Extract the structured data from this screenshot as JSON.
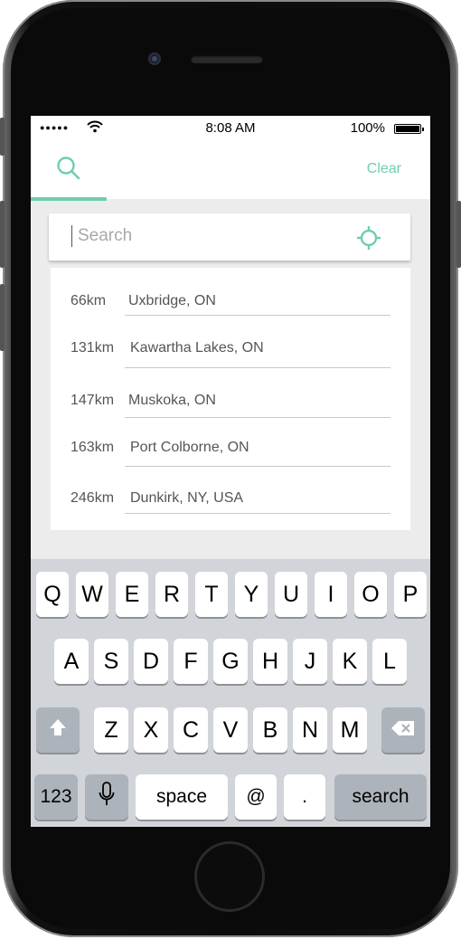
{
  "status_bar": {
    "signal": "●●●●●",
    "time": "8:08 AM",
    "battery_percent": "100%"
  },
  "header": {
    "search_tab_icon": "search-icon",
    "clear_label": "Clear"
  },
  "search": {
    "placeholder": "Search",
    "value": "",
    "locate_icon": "crosshair-icon"
  },
  "results": [
    {
      "distance": "66km",
      "place": "Uxbridge, ON"
    },
    {
      "distance": "131km",
      "place": "Kawartha Lakes, ON"
    },
    {
      "distance": "147km",
      "place": "Muskoka, ON"
    },
    {
      "distance": "163km",
      "place": "Port Colborne, ON"
    },
    {
      "distance": "246km",
      "place": "Dunkirk, NY, USA"
    }
  ],
  "keyboard": {
    "row1": [
      "Q",
      "W",
      "E",
      "R",
      "T",
      "Y",
      "U",
      "I",
      "O",
      "P"
    ],
    "row2": [
      "A",
      "S",
      "D",
      "F",
      "G",
      "H",
      "J",
      "K",
      "L"
    ],
    "row3": [
      "Z",
      "X",
      "C",
      "V",
      "B",
      "N",
      "M"
    ],
    "numbers_key": "123",
    "space_key": "space",
    "at_key": "@",
    "period_key": ".",
    "search_key": "search"
  },
  "colors": {
    "accent": "#6fcdb0",
    "background": "#ececec",
    "keyboard": "#d1d4d9"
  }
}
